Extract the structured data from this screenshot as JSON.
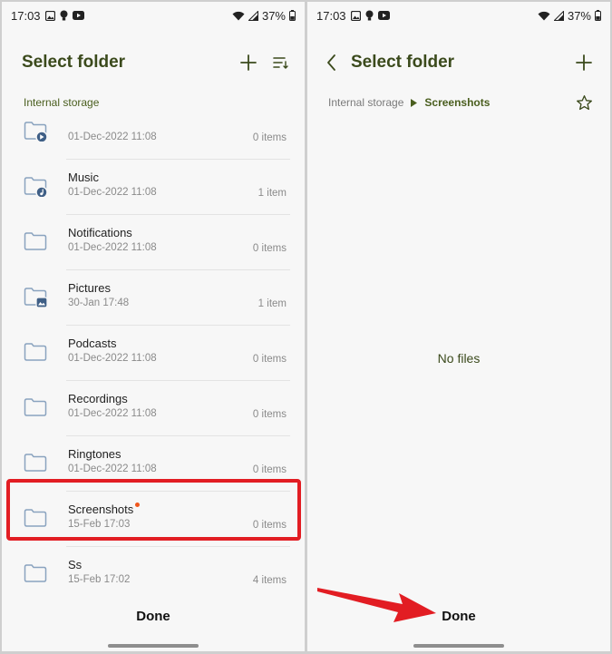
{
  "status": {
    "time": "17:03",
    "battery": "37%"
  },
  "left": {
    "title": "Select folder",
    "section_label": "Internal storage",
    "folders": [
      {
        "name": "",
        "date": "01-Dec-2022 11:08",
        "count": "0 items",
        "badge": "play"
      },
      {
        "name": "Music",
        "date": "01-Dec-2022 11:08",
        "count": "1 item",
        "badge": "music"
      },
      {
        "name": "Notifications",
        "date": "01-Dec-2022 11:08",
        "count": "0 items",
        "badge": ""
      },
      {
        "name": "Pictures",
        "date": "30-Jan 17:48",
        "count": "1 item",
        "badge": "image"
      },
      {
        "name": "Podcasts",
        "date": "01-Dec-2022 11:08",
        "count": "0 items",
        "badge": ""
      },
      {
        "name": "Recordings",
        "date": "01-Dec-2022 11:08",
        "count": "0 items",
        "badge": ""
      },
      {
        "name": "Ringtones",
        "date": "01-Dec-2022 11:08",
        "count": "0 items",
        "badge": ""
      },
      {
        "name": "Screenshots",
        "date": "15-Feb 17:03",
        "count": "0 items",
        "badge": "",
        "new": true,
        "highlighted": true
      },
      {
        "name": "Ss",
        "date": "15-Feb 17:02",
        "count": "4 items",
        "badge": ""
      }
    ],
    "done_label": "Done"
  },
  "right": {
    "title": "Select folder",
    "breadcrumb_root": "Internal storage",
    "breadcrumb_current": "Screenshots",
    "empty_message": "No files",
    "done_label": "Done"
  },
  "colors": {
    "accent": "#3b4a1c",
    "folder_stroke": "#8aa3bf",
    "badge_fill": "#3f5f86",
    "highlight": "#e21d23",
    "new_dot": "#f0571d"
  }
}
